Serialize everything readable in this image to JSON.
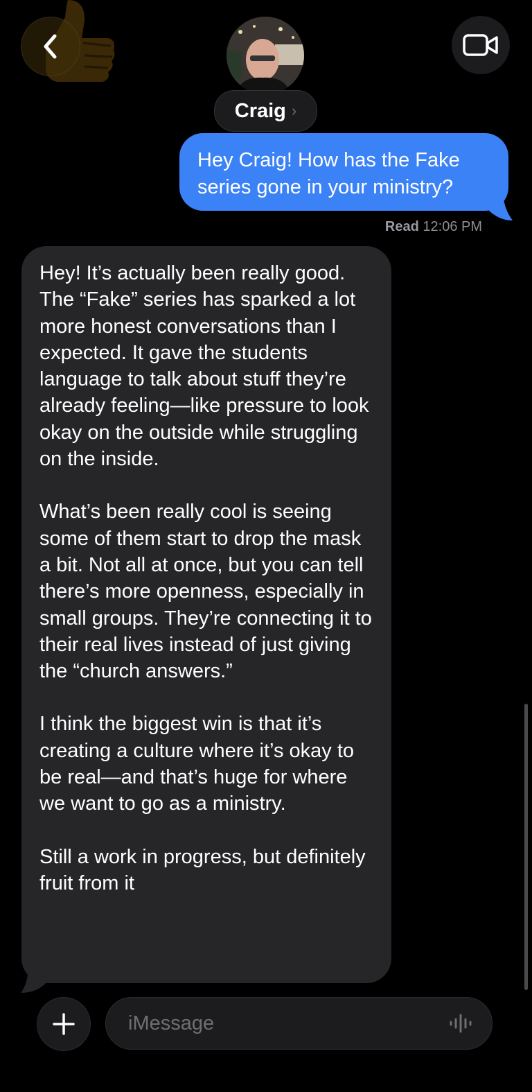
{
  "header": {
    "contact_name": "Craig",
    "back_icon": "chevron-left-icon",
    "video_icon": "video-camera-icon"
  },
  "messages": {
    "outgoing": {
      "text": "Hey Craig! How has the Fake series gone in your ministry?",
      "status_label": "Read",
      "time": "12:06 PM"
    },
    "incoming": {
      "paragraphs": [
        "Hey! It’s actually been really good. The “Fake” series has sparked a lot more honest conversations than I expected. It gave the students language to talk about stuff they’re already feeling—like pressure to look okay on the outside while struggling on the inside.",
        "What’s been really cool is seeing some of them start to drop the mask a bit. Not all at once, but you can tell there’s more openness, especially in small groups. They’re connecting it to their real lives instead of just giving the “church answers.”",
        "I think the biggest win is that it’s creating a culture where it’s okay to be real—and that’s huge for where we want to go as a ministry.",
        "Still a work in progress, but definitely fruit from it"
      ]
    }
  },
  "composer": {
    "placeholder": "iMessage",
    "plus_icon": "plus-icon",
    "voice_icon": "waveform-icon"
  },
  "colors": {
    "background": "#000000",
    "outgoing_bubble": "#3b82f6",
    "incoming_bubble": "#262628",
    "control_bg": "#1c1c1e"
  }
}
